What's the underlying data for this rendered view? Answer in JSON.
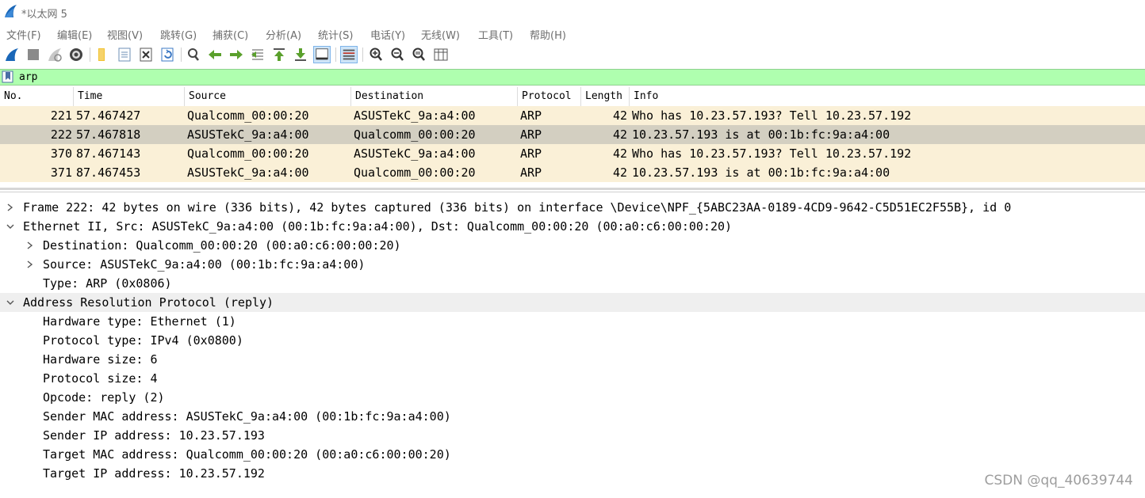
{
  "window": {
    "title": "*以太网 5"
  },
  "menu": [
    "文件(F)",
    "编辑(E)",
    "视图(V)",
    "跳转(G)",
    "捕获(C)",
    "分析(A)",
    "统计(S)",
    "电话(Y)",
    "无线(W)",
    "工具(T)",
    "帮助(H)"
  ],
  "toolbar_icons": [
    "start-capture-icon",
    "stop-capture-icon",
    "restart-capture-icon",
    "capture-options-icon",
    "open-file-icon",
    "save-file-icon",
    "close-file-icon",
    "reload-file-icon",
    "find-packet-icon",
    "go-back-icon",
    "go-forward-icon",
    "go-to-packet-icon",
    "go-first-packet-icon",
    "go-last-packet-icon",
    "auto-scroll-icon",
    "colorize-icon",
    "zoom-in-icon",
    "zoom-out-icon",
    "normal-size-icon",
    "resize-columns-icon"
  ],
  "filter": {
    "value": "arp"
  },
  "packet_list": {
    "columns": [
      "No.",
      "Time",
      "Source",
      "Destination",
      "Protocol",
      "Length",
      "Info"
    ],
    "rows": [
      {
        "no": "221",
        "time": "57.467427",
        "source": "Qualcomm_00:00:20",
        "destination": "ASUSTekC_9a:a4:00",
        "protocol": "ARP",
        "length": "42",
        "info": "Who has 10.23.57.193? Tell 10.23.57.192",
        "selected": false
      },
      {
        "no": "222",
        "time": "57.467818",
        "source": "ASUSTekC_9a:a4:00",
        "destination": "Qualcomm_00:00:20",
        "protocol": "ARP",
        "length": "42",
        "info": "10.23.57.193 is at 00:1b:fc:9a:a4:00",
        "selected": true
      },
      {
        "no": "370",
        "time": "87.467143",
        "source": "Qualcomm_00:00:20",
        "destination": "ASUSTekC_9a:a4:00",
        "protocol": "ARP",
        "length": "42",
        "info": "Who has 10.23.57.193? Tell 10.23.57.192",
        "selected": false
      },
      {
        "no": "371",
        "time": "87.467453",
        "source": "ASUSTekC_9a:a4:00",
        "destination": "Qualcomm_00:00:20",
        "protocol": "ARP",
        "length": "42",
        "info": "10.23.57.193 is at 00:1b:fc:9a:a4:00",
        "selected": false
      }
    ]
  },
  "details": [
    {
      "text": "Frame 222: 42 bytes on wire (336 bits), 42 bytes captured (336 bits) on interface \\Device\\NPF_{5ABC23AA-0189-4CD9-9642-C5D51EC2F55B}, id 0",
      "level": 0,
      "arrow": "collapsed",
      "highlight": false
    },
    {
      "text": "Ethernet II, Src: ASUSTekC_9a:a4:00 (00:1b:fc:9a:a4:00), Dst: Qualcomm_00:00:20 (00:a0:c6:00:00:20)",
      "level": 0,
      "arrow": "expanded",
      "highlight": false
    },
    {
      "text": "Destination: Qualcomm_00:00:20 (00:a0:c6:00:00:20)",
      "level": 1,
      "arrow": "collapsed",
      "highlight": false
    },
    {
      "text": "Source: ASUSTekC_9a:a4:00 (00:1b:fc:9a:a4:00)",
      "level": 1,
      "arrow": "collapsed",
      "highlight": false
    },
    {
      "text": "Type: ARP (0x0806)",
      "level": 1,
      "arrow": "none",
      "highlight": false
    },
    {
      "text": "Address Resolution Protocol (reply)",
      "level": 0,
      "arrow": "expanded",
      "highlight": true
    },
    {
      "text": "Hardware type: Ethernet (1)",
      "level": 1,
      "arrow": "none",
      "highlight": false
    },
    {
      "text": "Protocol type: IPv4 (0x0800)",
      "level": 1,
      "arrow": "none",
      "highlight": false
    },
    {
      "text": "Hardware size: 6",
      "level": 1,
      "arrow": "none",
      "highlight": false
    },
    {
      "text": "Protocol size: 4",
      "level": 1,
      "arrow": "none",
      "highlight": false
    },
    {
      "text": "Opcode: reply (2)",
      "level": 1,
      "arrow": "none",
      "highlight": false
    },
    {
      "text": "Sender MAC address: ASUSTekC_9a:a4:00 (00:1b:fc:9a:a4:00)",
      "level": 1,
      "arrow": "none",
      "highlight": false
    },
    {
      "text": "Sender IP address: 10.23.57.193",
      "level": 1,
      "arrow": "none",
      "highlight": false
    },
    {
      "text": "Target MAC address: Qualcomm_00:00:20 (00:a0:c6:00:00:20)",
      "level": 1,
      "arrow": "none",
      "highlight": false
    },
    {
      "text": "Target IP address: 10.23.57.192",
      "level": 1,
      "arrow": "none",
      "highlight": false
    }
  ],
  "watermark": "CSDN @qq_40639744",
  "colors": {
    "filter_valid_bg": "#afffaf",
    "row_bg": "#faf0d7",
    "row_selected_bg": "#d3cfc1",
    "detail_highlight_bg": "#efefef"
  }
}
